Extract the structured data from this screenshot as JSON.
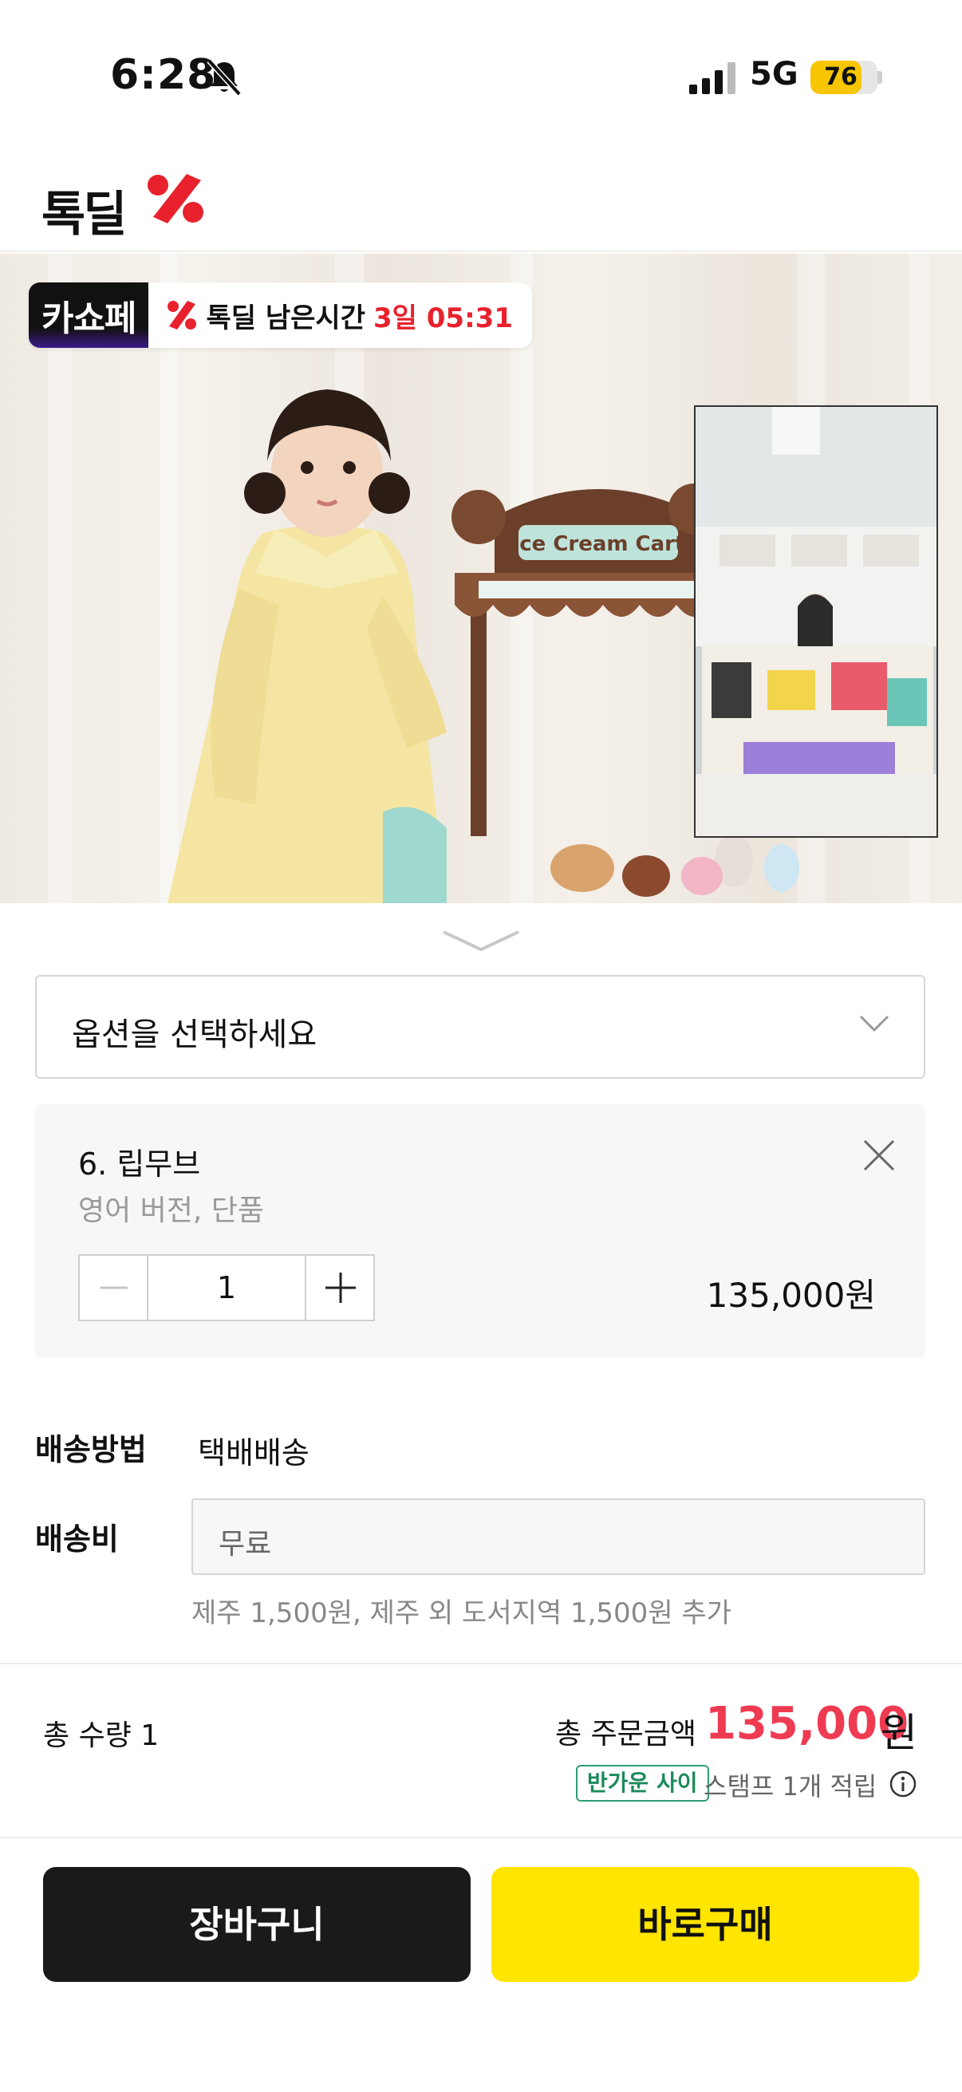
{
  "status_bar": {
    "time": "6:28",
    "network": "5G",
    "battery_level": "76",
    "battery_fraction": 0.76
  },
  "header": {
    "logo_text": "톡딜"
  },
  "hero": {
    "brand_badge": "카쇼페",
    "deal_label": "톡딜 남은시간",
    "deal_time": "3일 05:31",
    "accent": "#e8212d"
  },
  "option_select": {
    "placeholder": "옵션을 선택하세요"
  },
  "selected_option": {
    "name": "6. 립무브",
    "detail": "영어 버전, 단품",
    "quantity": "1",
    "price": "135,000원"
  },
  "shipping": {
    "method_label": "배송방법",
    "method_value": "택배배송",
    "fee_label": "배송비",
    "fee_value": "무료",
    "note": "제주 1,500원, 제주 외 도서지역 1,500원 추가"
  },
  "totals": {
    "quantity_text": "총 수량 1",
    "amount_label": "총 주문금액",
    "amount": "135,000",
    "currency": "원",
    "amount_color": "#ef3b52",
    "stamp_badge": "반가운 사이",
    "stamp_text": "스탬프 1개 적립"
  },
  "actions": {
    "cart_label": "장바구니",
    "buy_label": "바로구매",
    "buy_color": "#ffe500"
  },
  "icons": {
    "bell": "bell-slash-icon",
    "signal": "signal-icon",
    "chevron": "chevron-down-icon",
    "close": "close-icon",
    "info": "info-icon"
  }
}
